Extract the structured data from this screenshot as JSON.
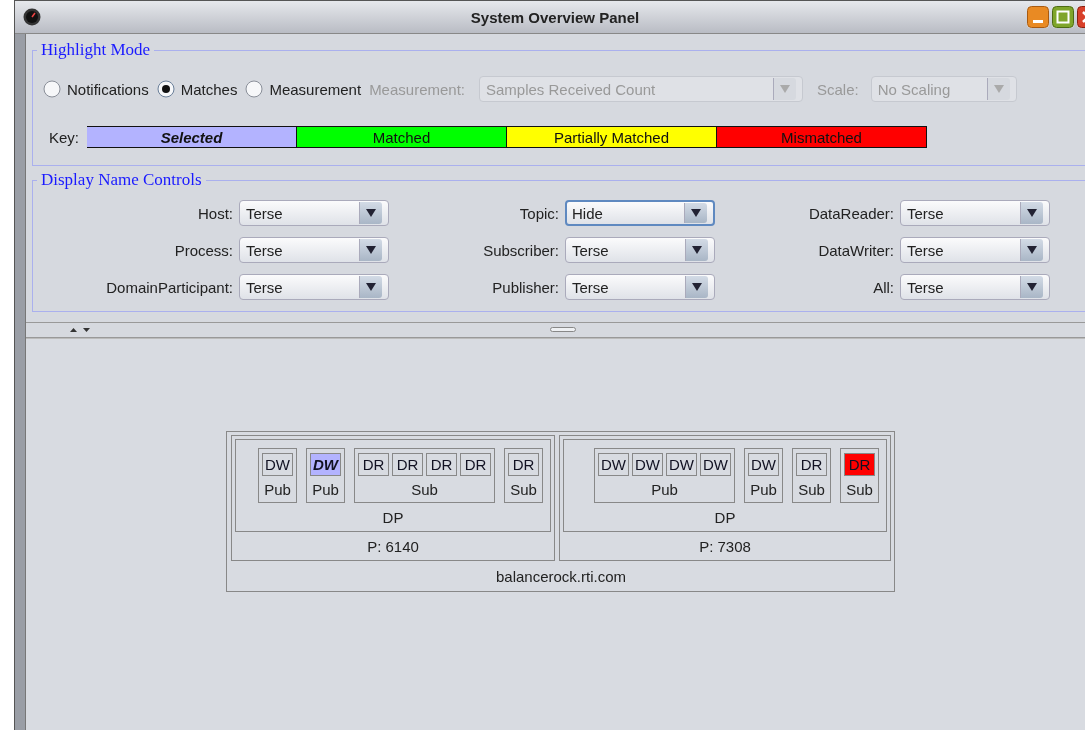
{
  "window": {
    "title": "System Overview Panel"
  },
  "highlight_mode": {
    "title": "Highlight Mode",
    "radios": [
      {
        "label": "Notifications",
        "selected": false
      },
      {
        "label": "Matches",
        "selected": true
      },
      {
        "label": "Measurement",
        "selected": false
      }
    ],
    "measurement_label": "Measurement:",
    "measurement_dropdown": {
      "value": "Samples Received Count",
      "disabled": true
    },
    "scale_label": "Scale:",
    "scale_dropdown": {
      "value": "No Scaling",
      "disabled": true
    },
    "key_label": "Key:",
    "key": [
      {
        "label": "Selected",
        "kind": "selected",
        "color": "#b3b3ff"
      },
      {
        "label": "Matched",
        "kind": "status",
        "color": "#00ff00"
      },
      {
        "label": "Partially Matched",
        "kind": "status",
        "color": "#ffff00"
      },
      {
        "label": "Mismatched",
        "kind": "status",
        "color": "#ff0000"
      }
    ]
  },
  "display_name_controls": {
    "title": "Display Name Controls",
    "fields": [
      {
        "label": "Host:",
        "value": "Terse",
        "focused": false
      },
      {
        "label": "Topic:",
        "value": "Hide",
        "focused": true
      },
      {
        "label": "DataReader:",
        "value": "Terse",
        "focused": false
      },
      {
        "label": "Process:",
        "value": "Terse",
        "focused": false
      },
      {
        "label": "Subscriber:",
        "value": "Terse",
        "focused": false
      },
      {
        "label": "DataWriter:",
        "value": "Terse",
        "focused": false
      },
      {
        "label": "DomainParticipant:",
        "value": "Terse",
        "focused": false
      },
      {
        "label": "Publisher:",
        "value": "Terse",
        "focused": false
      },
      {
        "label": "All:",
        "value": "Terse",
        "focused": false
      }
    ]
  },
  "host": {
    "label": "balancerock.rti.com",
    "processes": [
      {
        "label": "P: 6140",
        "participant": {
          "label": "DP",
          "groups": [
            {
              "label": "Pub",
              "entities": [
                {
                  "label": "DW",
                  "selected": false,
                  "mismatched": false
                }
              ]
            },
            {
              "label": "Pub",
              "entities": [
                {
                  "label": "DW",
                  "selected": true,
                  "mismatched": false
                }
              ]
            },
            {
              "label": "Sub",
              "entities": [
                {
                  "label": "DR",
                  "selected": false,
                  "mismatched": false
                },
                {
                  "label": "DR",
                  "selected": false,
                  "mismatched": false
                },
                {
                  "label": "DR",
                  "selected": false,
                  "mismatched": false
                },
                {
                  "label": "DR",
                  "selected": false,
                  "mismatched": false
                }
              ]
            },
            {
              "label": "Sub",
              "entities": [
                {
                  "label": "DR",
                  "selected": false,
                  "mismatched": false
                }
              ]
            }
          ]
        }
      },
      {
        "label": "P: 7308",
        "participant": {
          "label": "DP",
          "groups": [
            {
              "label": "Pub",
              "entities": [
                {
                  "label": "DW",
                  "selected": false,
                  "mismatched": false
                },
                {
                  "label": "DW",
                  "selected": false,
                  "mismatched": false
                },
                {
                  "label": "DW",
                  "selected": false,
                  "mismatched": false
                },
                {
                  "label": "DW",
                  "selected": false,
                  "mismatched": false
                }
              ]
            },
            {
              "label": "Pub",
              "entities": [
                {
                  "label": "DW",
                  "selected": false,
                  "mismatched": false
                }
              ]
            },
            {
              "label": "Sub",
              "entities": [
                {
                  "label": "DR",
                  "selected": false,
                  "mismatched": false
                }
              ]
            },
            {
              "label": "Sub",
              "entities": [
                {
                  "label": "DR",
                  "selected": false,
                  "mismatched": true
                }
              ]
            }
          ]
        }
      }
    ]
  }
}
